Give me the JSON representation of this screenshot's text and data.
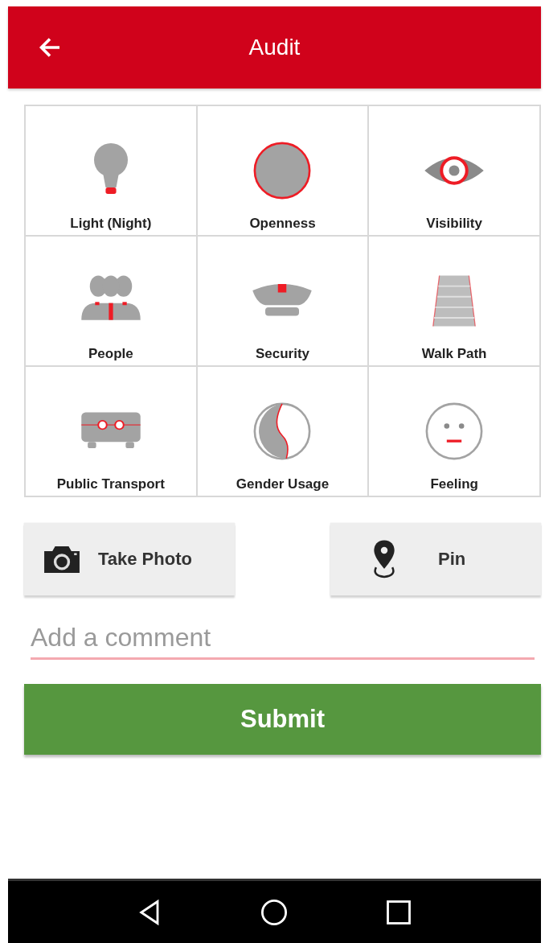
{
  "app_bar": {
    "title": "Audit"
  },
  "categories": [
    {
      "kind": "light",
      "label": "Light (Night)"
    },
    {
      "kind": "openness",
      "label": "Openness"
    },
    {
      "kind": "visibility",
      "label": "Visibility"
    },
    {
      "kind": "people",
      "label": "People"
    },
    {
      "kind": "security",
      "label": "Security"
    },
    {
      "kind": "walkpath",
      "label": "Walk Path"
    },
    {
      "kind": "transport",
      "label": "Public Transport"
    },
    {
      "kind": "gender",
      "label": "Gender Usage"
    },
    {
      "kind": "feeling",
      "label": "Feeling"
    }
  ],
  "actions": [
    {
      "kind": "camera",
      "label": "Take Photo"
    },
    {
      "kind": "pin",
      "label": "Pin"
    }
  ],
  "comment": {
    "placeholder": "Add a comment"
  },
  "submit": {
    "label": "Submit"
  }
}
